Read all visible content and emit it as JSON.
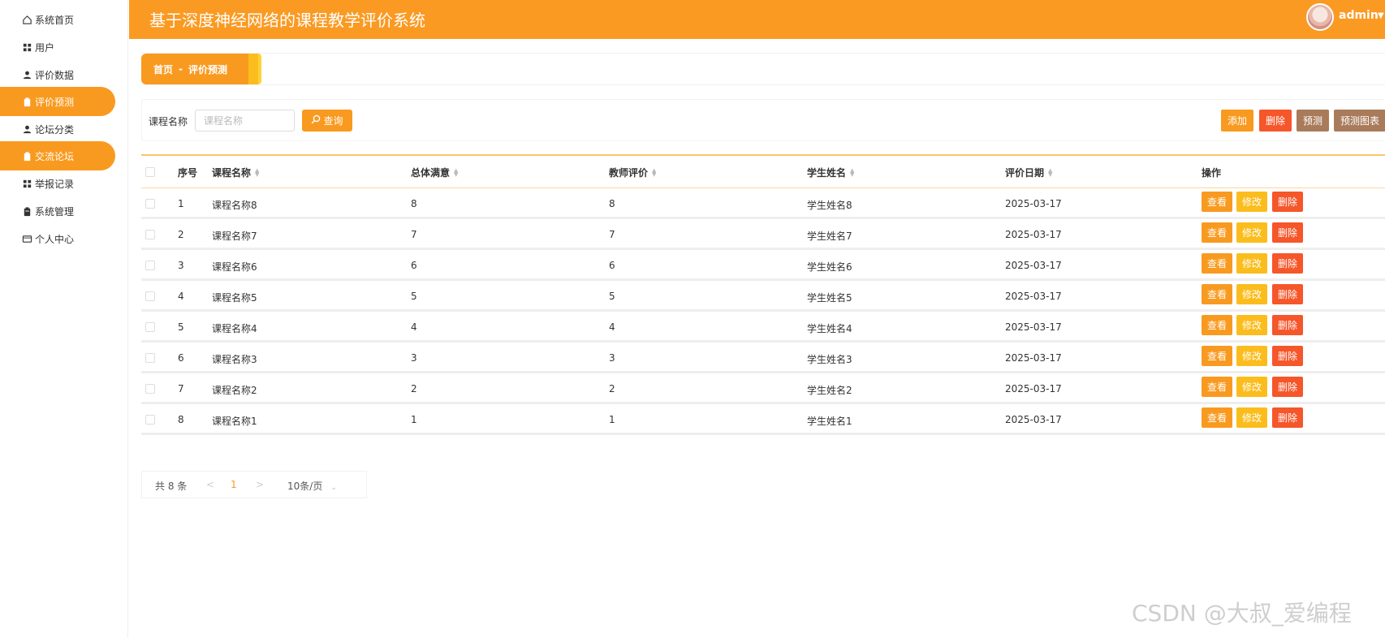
{
  "header": {
    "title": "基于深度神经网络的课程教学评价系统",
    "user": "admin"
  },
  "sidebar": {
    "items": [
      {
        "label": "系统首页",
        "icon": "home-icon"
      },
      {
        "label": "用户",
        "icon": "grid-icon"
      },
      {
        "label": "评价数据",
        "icon": "user-icon"
      },
      {
        "label": "评价预测",
        "icon": "clipboard-icon",
        "active": true
      },
      {
        "label": "论坛分类",
        "icon": "user-icon"
      },
      {
        "label": "交流论坛",
        "icon": "clipboard-icon",
        "hover": true
      },
      {
        "label": "举报记录",
        "icon": "grid-icon"
      },
      {
        "label": "系统管理",
        "icon": "clipboard-icon"
      },
      {
        "label": "个人中心",
        "icon": "id-card-icon"
      }
    ]
  },
  "breadcrumb": {
    "home": "首页",
    "separator": "-",
    "current": "评价预测"
  },
  "search": {
    "label": "课程名称",
    "placeholder": "课程名称",
    "value": "",
    "button": "查询"
  },
  "toolbar": {
    "add": "添加",
    "delete": "删除",
    "predict": "预测",
    "predict_chart": "预测图表"
  },
  "table": {
    "columns": [
      "序号",
      "课程名称",
      "总体满意",
      "教师评价",
      "学生姓名",
      "评价日期",
      "操作"
    ],
    "rows": [
      {
        "index": "1",
        "course": "课程名称8",
        "satisfaction": "8",
        "teacher": "8",
        "student": "学生姓名8",
        "date": "2025-03-17"
      },
      {
        "index": "2",
        "course": "课程名称7",
        "satisfaction": "7",
        "teacher": "7",
        "student": "学生姓名7",
        "date": "2025-03-17"
      },
      {
        "index": "3",
        "course": "课程名称6",
        "satisfaction": "6",
        "teacher": "6",
        "student": "学生姓名6",
        "date": "2025-03-17"
      },
      {
        "index": "4",
        "course": "课程名称5",
        "satisfaction": "5",
        "teacher": "5",
        "student": "学生姓名5",
        "date": "2025-03-17"
      },
      {
        "index": "5",
        "course": "课程名称4",
        "satisfaction": "4",
        "teacher": "4",
        "student": "学生姓名4",
        "date": "2025-03-17"
      },
      {
        "index": "6",
        "course": "课程名称3",
        "satisfaction": "3",
        "teacher": "3",
        "student": "学生姓名3",
        "date": "2025-03-17"
      },
      {
        "index": "7",
        "course": "课程名称2",
        "satisfaction": "2",
        "teacher": "2",
        "student": "学生姓名2",
        "date": "2025-03-17"
      },
      {
        "index": "8",
        "course": "课程名称1",
        "satisfaction": "1",
        "teacher": "1",
        "student": "学生姓名1",
        "date": "2025-03-17"
      }
    ],
    "actions": {
      "view": "查看",
      "edit": "修改",
      "delete": "删除"
    }
  },
  "pagination": {
    "total": "共 8 条",
    "prev": "<",
    "page": "1",
    "next": ">",
    "page_size": "10条/页"
  },
  "watermark": "CSDN @大叔_爱编程",
  "colors": {
    "primary": "#f99a20",
    "header": "#fb9a22",
    "edit": "#fbbd1d",
    "danger": "#f5562a",
    "brown": "#a97b5b",
    "pager_active": "#f99a20"
  }
}
